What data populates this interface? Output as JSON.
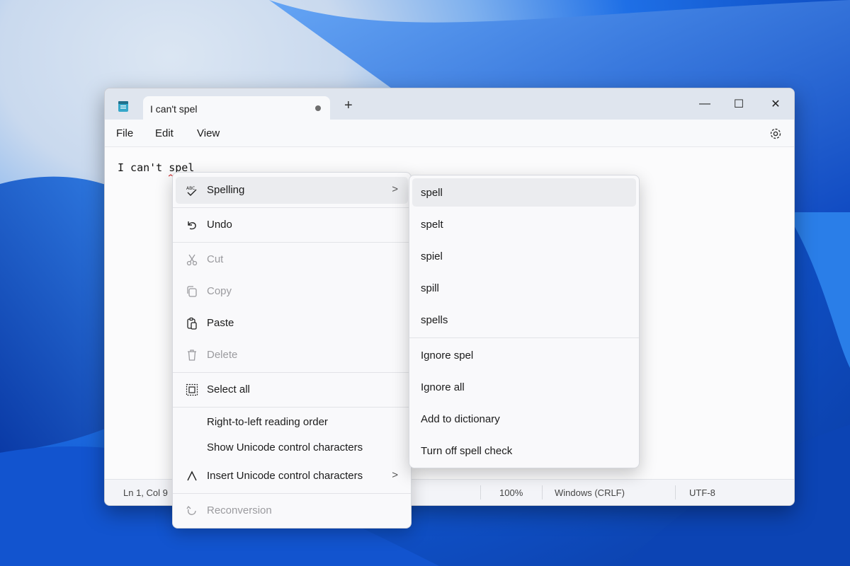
{
  "window": {
    "tab_title": "I can't spel",
    "new_tab_symbol": "+",
    "minimize_symbol": "—",
    "maximize_symbol": "☐",
    "close_symbol": "✕"
  },
  "menubar": {
    "file": "File",
    "edit": "Edit",
    "view": "View"
  },
  "editor": {
    "text": "I can't spel"
  },
  "statusbar": {
    "position": "Ln 1, Col 9",
    "zoom": "100%",
    "line_endings": "Windows (CRLF)",
    "encoding": "UTF-8"
  },
  "context_menu": {
    "spelling": "Spelling",
    "undo": "Undo",
    "cut": "Cut",
    "copy": "Copy",
    "paste": "Paste",
    "delete": "Delete",
    "select_all": "Select all",
    "rtl": "Right-to-left reading order",
    "show_unicode": "Show Unicode control characters",
    "insert_unicode": "Insert Unicode control characters",
    "reconversion": "Reconversion",
    "chevron": ">",
    "spelling_icon_text": "ABC"
  },
  "spelling_submenu": {
    "suggestions": [
      "spell",
      "spelt",
      "spiel",
      "spill",
      "spells"
    ],
    "ignore": "Ignore spel",
    "ignore_all": "Ignore all",
    "add_dictionary": "Add to dictionary",
    "turn_off": "Turn off spell check"
  },
  "colors": {
    "accent": "#1e6fe6",
    "squiggle": "#d13438"
  }
}
